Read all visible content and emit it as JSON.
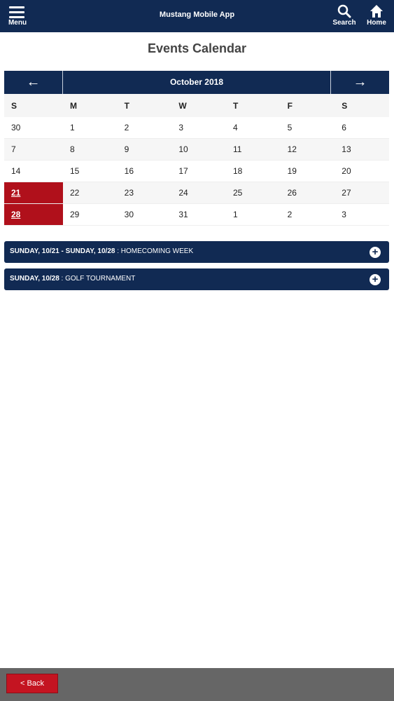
{
  "header": {
    "menu_label": "Menu",
    "app_title": "Mustang Mobile App",
    "search_label": "Search",
    "home_label": "Home"
  },
  "page_title": "Events Calendar",
  "calendar": {
    "month": "October 2018",
    "prev_arrow": "←",
    "next_arrow": "→",
    "weekdays": [
      "S",
      "M",
      "T",
      "W",
      "T",
      "F",
      "S"
    ],
    "weeks": [
      [
        "30",
        "1",
        "2",
        "3",
        "4",
        "5",
        "6"
      ],
      [
        "7",
        "8",
        "9",
        "10",
        "11",
        "12",
        "13"
      ],
      [
        "14",
        "15",
        "16",
        "17",
        "18",
        "19",
        "20"
      ],
      [
        "21",
        "22",
        "23",
        "24",
        "25",
        "26",
        "27"
      ],
      [
        "28",
        "29",
        "30",
        "31",
        "1",
        "2",
        "3"
      ]
    ],
    "event_days": [
      "21",
      "28"
    ]
  },
  "events": [
    {
      "date": "SUNDAY, 10/21 - SUNDAY, 10/28",
      "name": " : HOMECOMING WEEK"
    },
    {
      "date": "SUNDAY, 10/28",
      "name": " : GOLF TOURNAMENT"
    }
  ],
  "footer": {
    "back_label": "< Back"
  },
  "colors": {
    "navy": "#112a53",
    "event_red": "#b0101b",
    "footer_gray": "#666666",
    "back_red": "#c41421"
  }
}
